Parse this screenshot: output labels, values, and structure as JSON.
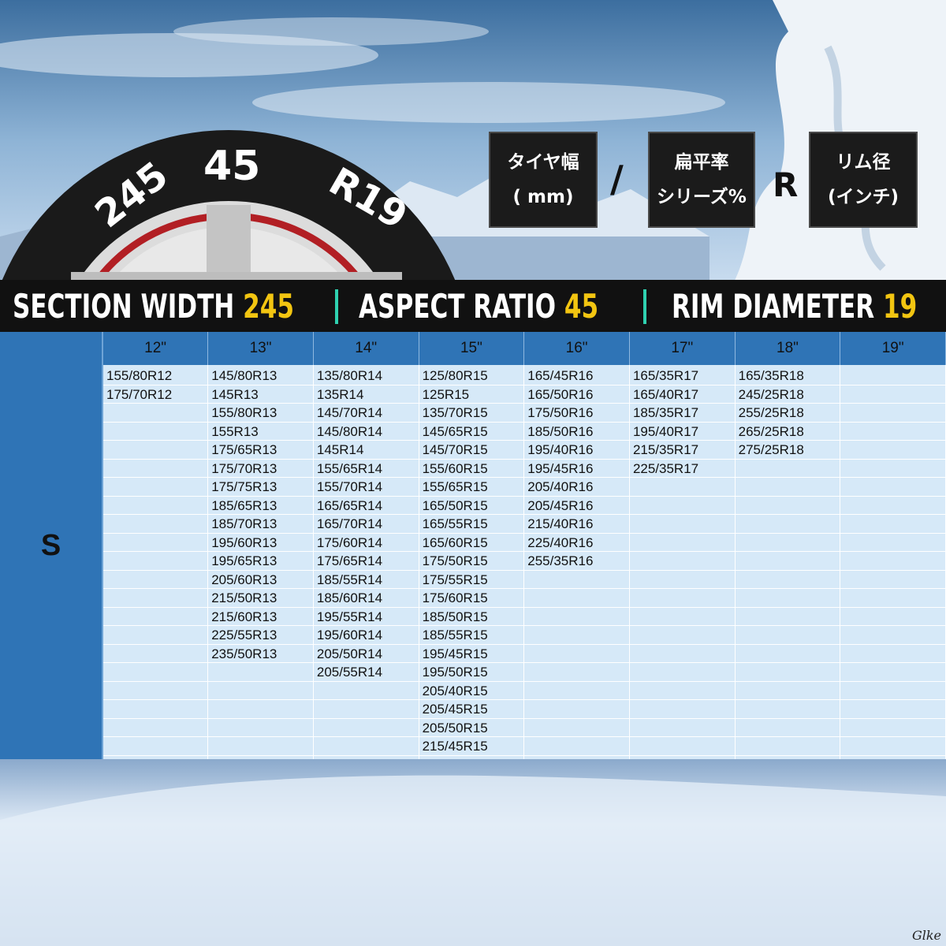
{
  "tire_graphic": {
    "width_label": "245",
    "aspect_label": "45",
    "rim_label": "R19"
  },
  "legend": {
    "width_box": {
      "line1": "タイヤ幅",
      "line2": "( mm)"
    },
    "slash": "/",
    "aspect_box": {
      "line1": "扁平率",
      "line2": "シリーズ%"
    },
    "r_letter": "R",
    "rim_box": {
      "line1": "リム径",
      "line2": "(インチ)"
    }
  },
  "title_band": {
    "section_width_label": "SECTION WIDTH",
    "section_width_value": "245",
    "aspect_ratio_label": "ASPECT RATIO",
    "aspect_ratio_value": "45",
    "rim_diameter_label": "RIM DIAMETER",
    "rim_diameter_value": "19",
    "accent_color": "#f2c511",
    "divider_color": "#2fd1b0"
  },
  "size_table": {
    "tier": "S",
    "columns": [
      {
        "header": "12\"",
        "sizes": [
          "155/80R12",
          "175/70R12"
        ]
      },
      {
        "header": "13\"",
        "sizes": [
          "145/80R13",
          "145R13",
          "155/80R13",
          "155R13",
          "175/65R13",
          "175/70R13",
          "175/75R13",
          "185/65R13",
          "185/70R13",
          "195/60R13",
          "195/65R13",
          "205/60R13",
          "215/50R13",
          "215/60R13",
          "225/55R13",
          "235/50R13"
        ]
      },
      {
        "header": "14\"",
        "sizes": [
          "135/80R14",
          "135R14",
          "145/70R14",
          "145/80R14",
          "145R14",
          "155/65R14",
          "155/70R14",
          "165/65R14",
          "165/70R14",
          "175/60R14",
          "175/65R14",
          "185/55R14",
          "185/60R14",
          "195/55R14",
          "195/60R14",
          "205/50R14",
          "205/55R14"
        ]
      },
      {
        "header": "15\"",
        "sizes": [
          "125/80R15",
          "125R15",
          "135/70R15",
          "145/65R15",
          "145/70R15",
          "155/60R15",
          "155/65R15",
          "165/50R15",
          "165/55R15",
          "165/60R15",
          "175/50R15",
          "175/55R15",
          "175/60R15",
          "185/50R15",
          "185/55R15",
          "195/45R15",
          "195/50R15",
          "205/40R15",
          "205/45R15",
          "205/50R15",
          "215/45R15"
        ]
      },
      {
        "header": "16\"",
        "sizes": [
          "165/45R16",
          "165/50R16",
          "175/50R16",
          "185/50R16",
          "195/40R16",
          "195/45R16",
          "205/40R16",
          "205/45R16",
          "215/40R16",
          "225/40R16",
          "255/35R16"
        ]
      },
      {
        "header": "17\"",
        "sizes": [
          "165/35R17",
          "165/40R17",
          "185/35R17",
          "195/40R17",
          "215/35R17",
          "225/35R17"
        ]
      },
      {
        "header": "18\"",
        "sizes": [
          "165/35R18",
          "245/25R18",
          "255/25R18",
          "265/25R18",
          "275/25R18"
        ]
      },
      {
        "header": "19\"",
        "sizes": []
      }
    ]
  },
  "signature": "Glke"
}
